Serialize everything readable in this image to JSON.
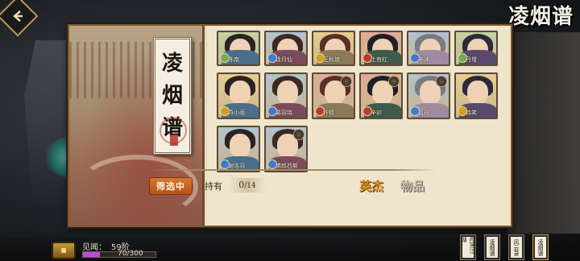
{
  "header": {
    "logo_text": "凌烟谱",
    "back_icon": "back-arrow-icon"
  },
  "panel": {
    "title_chars": [
      "凌",
      "烟",
      "谱"
    ]
  },
  "heroes": [
    {
      "name": "陈南",
      "element": "wood",
      "color": "#6ab04c",
      "row_partial": true
    },
    {
      "name": "徐月仙",
      "element": "water",
      "color": "#3a7bd5",
      "row_partial": true
    },
    {
      "name": "王秋娘",
      "element": "earth",
      "color": "#d4a017",
      "row_partial": true
    },
    {
      "name": "上官红",
      "element": "fire",
      "color": "#c0392b",
      "row_partial": true
    },
    {
      "name": "辛冰",
      "element": "water",
      "color": "#3a7bd5",
      "row_partial": true
    },
    {
      "name": "丹增",
      "element": "wood",
      "color": "#6ab04c",
      "row_partial": true
    },
    {
      "name": "燕小雨",
      "element": "earth",
      "color": "#d4a017"
    },
    {
      "name": "慕容晓",
      "element": "water",
      "color": "#3a7bd5"
    },
    {
      "name": "许倩",
      "element": "fire",
      "color": "#c0392b"
    },
    {
      "name": "辛卯",
      "element": "fire",
      "color": "#c0392b"
    },
    {
      "name": "蓝玫",
      "element": "water",
      "color": "#3a7bd5"
    },
    {
      "name": "韩笑",
      "element": "earth",
      "color": "#d4a017"
    },
    {
      "name": "谢洛羽",
      "element": "water",
      "color": "#3a7bd5"
    },
    {
      "name": "佛郎西斯",
      "element": "water",
      "color": "#3a7bd5"
    }
  ],
  "footer": {
    "filter_label": "筛选中",
    "own_label": "持有",
    "own_count": "0",
    "own_total": "/14",
    "hero_seal": "英杰",
    "item_seal": "物品"
  },
  "status": {
    "exp_label": "见闻：",
    "level": "59阶",
    "exp_current": "70",
    "exp_max": "300",
    "exp_fraction": 0.233
  },
  "scroll_tabs": [
    {
      "label": "闯荡江湖",
      "active": false
    },
    {
      "label": "凌烟谱",
      "active": false
    },
    {
      "label": "风云录",
      "active": false
    },
    {
      "label": "凌烟谱",
      "active": true
    }
  ]
}
